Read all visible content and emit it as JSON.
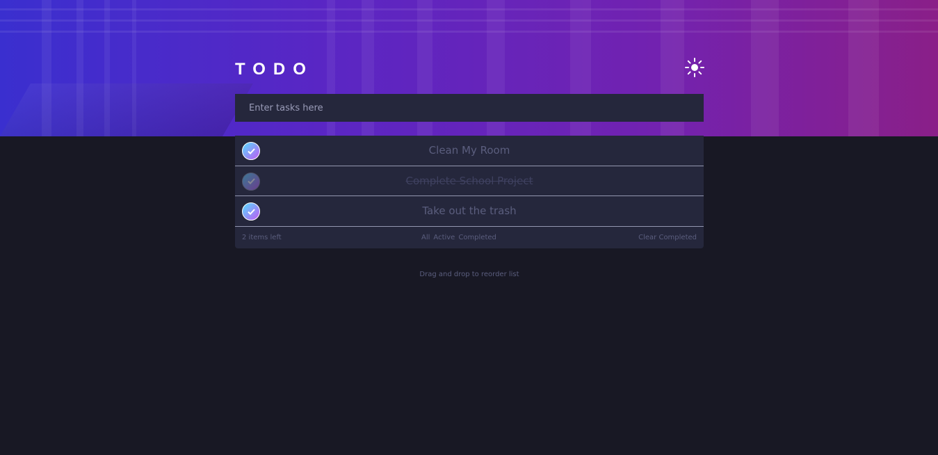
{
  "header": {
    "title": "TODO",
    "theme_icon": "sun-icon"
  },
  "input": {
    "placeholder": "Enter tasks here",
    "value": ""
  },
  "todos": [
    {
      "label": "Clean My Room",
      "completed": false
    },
    {
      "label": "Complete School Project",
      "completed": true
    },
    {
      "label": "Take out the trash",
      "completed": false
    }
  ],
  "footer": {
    "items_left": "2 items left",
    "filters": {
      "all": "All",
      "active": "Active",
      "completed": "Completed"
    },
    "clear_completed": "Clear Completed"
  },
  "hint": "Drag and drop to reorder list",
  "colors": {
    "background": "#181824",
    "card": "#25273c",
    "check_gradient_start": "#55ddff",
    "check_gradient_end": "#c058f3",
    "hero_start": "#3a2fcf",
    "hero_end": "#8a1f88"
  }
}
